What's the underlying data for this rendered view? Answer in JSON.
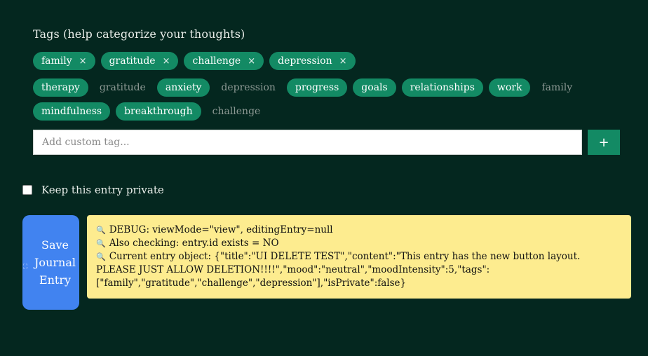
{
  "tags_section": {
    "heading": "Tags (help categorize your thoughts)",
    "selected": [
      {
        "label": "family",
        "remove": "×"
      },
      {
        "label": "gratitude",
        "remove": "×"
      },
      {
        "label": "challenge",
        "remove": "×"
      },
      {
        "label": "depression",
        "remove": "×"
      }
    ],
    "suggestions_row1": [
      {
        "label": "therapy",
        "state": "unselected-highlight"
      },
      {
        "label": "gratitude",
        "state": "used"
      },
      {
        "label": "anxiety",
        "state": "unselected-highlight"
      },
      {
        "label": "depression",
        "state": "used"
      },
      {
        "label": "progress",
        "state": "unselected-highlight"
      },
      {
        "label": "goals",
        "state": "unselected-highlight"
      },
      {
        "label": "relationships",
        "state": "unselected-highlight"
      },
      {
        "label": "work",
        "state": "unselected-highlight"
      },
      {
        "label": "family",
        "state": "used"
      }
    ],
    "suggestions_row2": [
      {
        "label": "mindfulness",
        "state": "unselected-highlight"
      },
      {
        "label": "breakthrough",
        "state": "unselected-highlight"
      },
      {
        "label": "challenge",
        "state": "used"
      }
    ],
    "custom_input": {
      "placeholder": "Add custom tag...",
      "value": ""
    },
    "add_button": "+"
  },
  "privacy": {
    "label": "Keep this entry private",
    "checked": false
  },
  "save_button": {
    "label": "Save Journal Entry",
    "icon": "save-icon"
  },
  "debug": {
    "icon": "magnifier-icon",
    "line1": "DEBUG: viewMode=\"view\", editingEntry=null",
    "line2": "Also checking: entry.id exists = NO",
    "line3": "Current entry object: {\"title\":\"UI DELETE TEST\",\"content\":\"This entry has the new button layout. PLEASE JUST ALLOW DELETION!!!!\",\"mood\":\"neutral\",\"moodIntensity\":5,\"tags\":[\"family\",\"gratitude\",\"challenge\",\"depression\"],\"isPrivate\":false}"
  },
  "colors": {
    "background": "#04271f",
    "tag_green": "#138a64",
    "save_blue": "#4183f0",
    "debug_yellow": "#fdec8f"
  }
}
